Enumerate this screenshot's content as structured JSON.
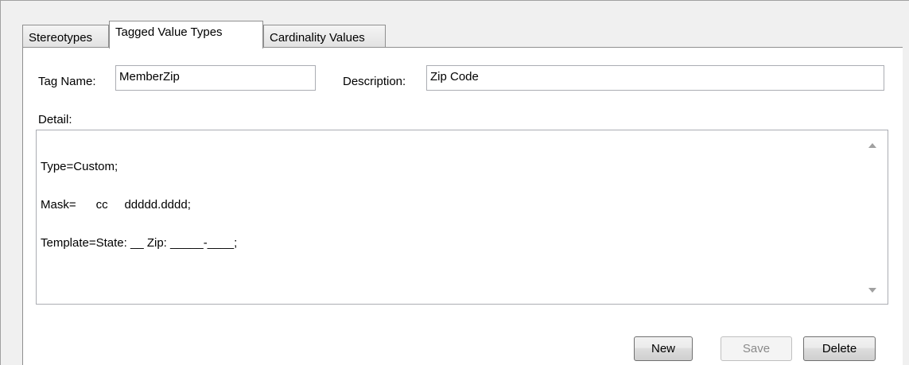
{
  "tabs": [
    {
      "label": "Stereotypes",
      "active": false
    },
    {
      "label": "Tagged Value Types",
      "active": true
    },
    {
      "label": "Cardinality Values",
      "active": false
    }
  ],
  "form": {
    "tag_name_label": "Tag Name:",
    "tag_name_value": "MemberZip",
    "description_label": "Description:",
    "description_value": "Zip Code",
    "detail_label": "Detail:",
    "detail_lines": [
      "Type=Custom;",
      "Mask=      cc     ddddd.dddd;",
      "Template=State: __ Zip: _____-____;"
    ]
  },
  "buttons": {
    "new_label": "New",
    "save_label": "Save",
    "save_enabled": false,
    "delete_label": "Delete"
  },
  "icons": {
    "scroll_up": "scroll-up-arrow-icon",
    "scroll_down": "scroll-down-arrow-icon"
  },
  "colors": {
    "window_bg": "#f0f0f0",
    "panel_bg": "#ffffff",
    "border": "#8f8f8f",
    "disabled_text": "#8a8a8a"
  }
}
